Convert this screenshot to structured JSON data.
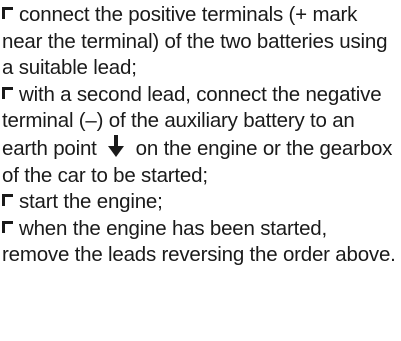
{
  "steps": [
    {
      "text": "connect the positive terminals (+ mark near the terminal) of the two batteries using a suitable lead;"
    },
    {
      "text_before_icon": "with a second lead, connect the negative terminal (–) of the auxiliary battery to an earth point",
      "icon": "earth-ground-icon",
      "text_after_icon": "on the engine or the gearbox of the car to be started;"
    },
    {
      "text": "start the engine;"
    },
    {
      "text": "when the engine has been started, remove the leads reversing the order above."
    }
  ],
  "colors": {
    "text": "#1a1a1a",
    "bullet": "#1a1a1a"
  }
}
